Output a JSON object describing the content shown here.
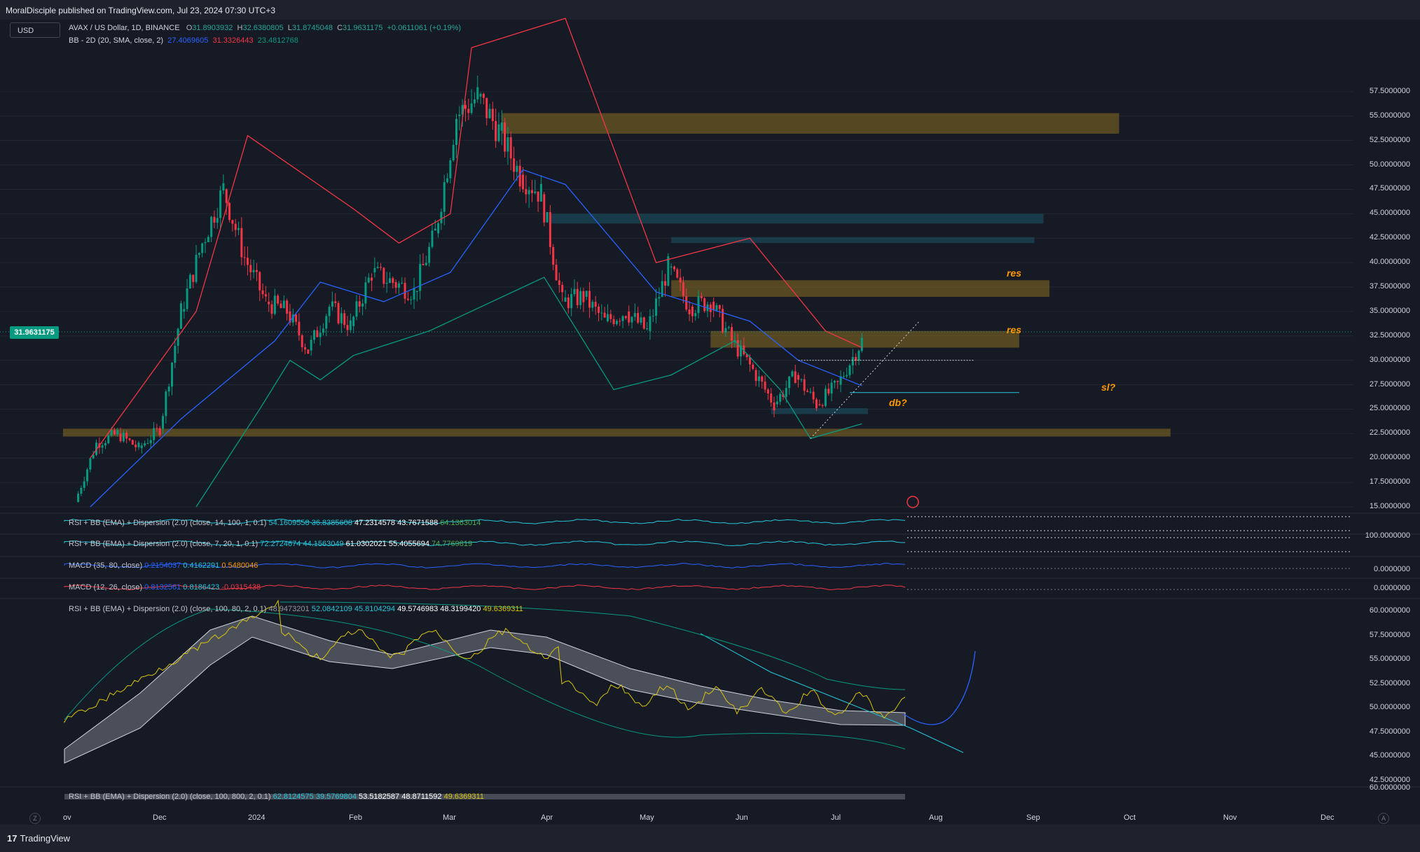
{
  "header": {
    "published_by": "MoralDisciple published on TradingView.com, Jul 23, 2024 07:30 UTC+3"
  },
  "currency_selector": "USD",
  "main_legend": {
    "symbol": "AVAX / US Dollar, 1D, BINANCE",
    "open_label": "O",
    "open": "31.8903932",
    "high_label": "H",
    "high": "32.6380805",
    "low_label": "L",
    "low": "31.8745048",
    "close_label": "C",
    "close": "31.9631175",
    "change": "+0.0611061 (+0.19%)"
  },
  "bb_legend": {
    "name": "BB - 2D (20, SMA, close, 2)",
    "basis": "27.4069605",
    "upper": "31.3326443",
    "lower": "23.4812768"
  },
  "last_price_tag": "31.9631175",
  "annotations": {
    "res1": "res",
    "res2": "res",
    "sl": "sl?",
    "db": "db?"
  },
  "panes": {
    "rsi1": {
      "name": "RSI + BB (EMA) + Dispersion (2.0) (close, 14, 100, 1, 0.1)",
      "v1": "54.1609558",
      "v2": "36.8385608",
      "v3": "47.2314578",
      "v4": "43.7671588",
      "v5": "64.1363014"
    },
    "rsi2": {
      "name": "RSI + BB (EMA) + Dispersion (2.0) (close, 7, 20, 1, 0.1)",
      "v1": "72.2724674",
      "v2": "44.1563049",
      "v3": "61.0302021",
      "v4": "55.4055694",
      "v5": "74.7769819",
      "axis": "100.0000000"
    },
    "macd1": {
      "name": "MACD (35, 80, close)",
      "v1": "0.2154037",
      "v2": "0.4162291",
      "v3": "0.5480046",
      "axis": "0.0000000"
    },
    "macd2": {
      "name": "MACD (12, 26, close)",
      "v1": "0.8132561",
      "v2": "0.8186423",
      "v3": "-0.0315438",
      "axis": "0.0000000"
    },
    "rsi3": {
      "name": "RSI + BB (EMA) + Dispersion (2.0) (close, 100, 80, 2, 0.1)",
      "v0": "48.9473201",
      "v1": "52.0842109",
      "v2": "45.8104294",
      "v3": "49.5746983",
      "v4": "48.3199420",
      "v5": "49.6369311",
      "axis_labels": [
        "60.0000000",
        "57.5000000",
        "55.0000000",
        "52.5000000",
        "50.0000000",
        "47.5000000",
        "45.0000000",
        "42.5000000"
      ]
    },
    "rsi4": {
      "name": "RSI + BB (EMA) + Dispersion (2.0) (close, 100, 800, 2, 0.1)",
      "v1": "62.8124575",
      "v2": "39.5769804",
      "v3": "53.5182587",
      "v4": "48.8711592",
      "v5": "49.6369311",
      "axis": "60.0000000"
    }
  },
  "price_axis_labels": [
    "57.5000000",
    "55.0000000",
    "52.5000000",
    "50.0000000",
    "47.5000000",
    "45.0000000",
    "42.5000000",
    "40.0000000",
    "37.5000000",
    "35.0000000",
    "32.5000000",
    "30.0000000",
    "27.5000000",
    "25.0000000",
    "22.5000000",
    "20.0000000",
    "17.5000000",
    "15.0000000"
  ],
  "time_axis_labels": [
    "ov",
    "Dec",
    "2024",
    "Feb",
    "Mar",
    "Apr",
    "May",
    "Jun",
    "Jul",
    "Aug",
    "Sep",
    "Oct",
    "Nov",
    "Dec"
  ],
  "footer": {
    "logo_glyph": "17",
    "brand": "TradingView",
    "left_btn": "Z",
    "right_btn": "A"
  },
  "colors": {
    "up": "#089981",
    "down": "#f23645",
    "bb_basis": "#2962ff",
    "bb_upper": "#f23645",
    "bb_lower": "#089981",
    "zone_orange": "#8a6d1f",
    "zone_blue": "#1e5566"
  },
  "chart_data": {
    "type": "candlestick",
    "title": "AVAX / US Dollar, 1D, BINANCE",
    "y_range": [
      15,
      60
    ],
    "x_range": [
      "2023-11-01",
      "2024-12-31"
    ],
    "close_path": [
      {
        "date": "2023-11-05",
        "close": 15.5
      },
      {
        "date": "2023-11-12",
        "close": 21.5
      },
      {
        "date": "2023-11-19",
        "close": 22.5
      },
      {
        "date": "2023-11-26",
        "close": 21.0
      },
      {
        "date": "2023-12-03",
        "close": 23.0
      },
      {
        "date": "2023-12-10",
        "close": 35.0
      },
      {
        "date": "2023-12-17",
        "close": 42.0
      },
      {
        "date": "2023-12-24",
        "close": 47.5
      },
      {
        "date": "2023-12-31",
        "close": 40.5
      },
      {
        "date": "2024-01-07",
        "close": 36.0
      },
      {
        "date": "2024-01-14",
        "close": 35.0
      },
      {
        "date": "2024-01-21",
        "close": 31.0
      },
      {
        "date": "2024-01-28",
        "close": 35.5
      },
      {
        "date": "2024-02-04",
        "close": 33.5
      },
      {
        "date": "2024-02-11",
        "close": 39.0
      },
      {
        "date": "2024-02-18",
        "close": 38.0
      },
      {
        "date": "2024-02-25",
        "close": 37.0
      },
      {
        "date": "2024-03-03",
        "close": 43.0
      },
      {
        "date": "2024-03-10",
        "close": 55.0
      },
      {
        "date": "2024-03-17",
        "close": 57.0
      },
      {
        "date": "2024-03-24",
        "close": 53.5
      },
      {
        "date": "2024-03-31",
        "close": 49.0
      },
      {
        "date": "2024-04-07",
        "close": 47.0
      },
      {
        "date": "2024-04-14",
        "close": 36.0
      },
      {
        "date": "2024-04-21",
        "close": 36.5
      },
      {
        "date": "2024-04-28",
        "close": 34.0
      },
      {
        "date": "2024-05-05",
        "close": 35.0
      },
      {
        "date": "2024-05-12",
        "close": 33.0
      },
      {
        "date": "2024-05-19",
        "close": 39.5
      },
      {
        "date": "2024-05-26",
        "close": 35.5
      },
      {
        "date": "2024-06-02",
        "close": 36.0
      },
      {
        "date": "2024-06-09",
        "close": 32.0
      },
      {
        "date": "2024-06-16",
        "close": 29.0
      },
      {
        "date": "2024-06-23",
        "close": 25.5
      },
      {
        "date": "2024-06-30",
        "close": 28.5
      },
      {
        "date": "2024-07-07",
        "close": 25.5
      },
      {
        "date": "2024-07-14",
        "close": 27.5
      },
      {
        "date": "2024-07-22",
        "close": 32.0
      }
    ],
    "bb_basis": [
      {
        "date": "2023-11-10",
        "value": 15.0
      },
      {
        "date": "2023-12-10",
        "value": 24.0
      },
      {
        "date": "2024-01-10",
        "value": 32.0
      },
      {
        "date": "2024-01-25",
        "value": 38.0
      },
      {
        "date": "2024-02-15",
        "value": 36.0
      },
      {
        "date": "2024-03-08",
        "value": 39.0
      },
      {
        "date": "2024-04-01",
        "value": 49.5
      },
      {
        "date": "2024-04-15",
        "value": 48.0
      },
      {
        "date": "2024-05-15",
        "value": 37.0
      },
      {
        "date": "2024-06-15",
        "value": 34.0
      },
      {
        "date": "2024-07-01",
        "value": 30.0
      },
      {
        "date": "2024-07-22",
        "value": 27.4
      }
    ],
    "bb_upper": [
      {
        "date": "2023-11-10",
        "value": 20.0
      },
      {
        "date": "2023-12-15",
        "value": 35.0
      },
      {
        "date": "2024-01-01",
        "value": 53.0
      },
      {
        "date": "2024-01-15",
        "value": 50.0
      },
      {
        "date": "2024-02-05",
        "value": 45.5
      },
      {
        "date": "2024-02-20",
        "value": 42.0
      },
      {
        "date": "2024-03-08",
        "value": 45.0
      },
      {
        "date": "2024-03-15",
        "value": 62.0
      },
      {
        "date": "2024-04-15",
        "value": 65.0
      },
      {
        "date": "2024-05-15",
        "value": 40.0
      },
      {
        "date": "2024-06-15",
        "value": 42.5
      },
      {
        "date": "2024-07-10",
        "value": 33.0
      },
      {
        "date": "2024-07-22",
        "value": 31.3
      }
    ],
    "bb_lower": [
      {
        "date": "2023-12-15",
        "value": 15.0
      },
      {
        "date": "2024-01-05",
        "value": 25.0
      },
      {
        "date": "2024-01-15",
        "value": 30.0
      },
      {
        "date": "2024-01-25",
        "value": 28.0
      },
      {
        "date": "2024-02-05",
        "value": 30.5
      },
      {
        "date": "2024-03-01",
        "value": 33.0
      },
      {
        "date": "2024-04-08",
        "value": 38.5
      },
      {
        "date": "2024-05-01",
        "value": 27.0
      },
      {
        "date": "2024-05-20",
        "value": 28.5
      },
      {
        "date": "2024-06-10",
        "value": 32.0
      },
      {
        "date": "2024-06-25",
        "value": 27.0
      },
      {
        "date": "2024-07-05",
        "value": 22.0
      },
      {
        "date": "2024-07-22",
        "value": 23.5
      }
    ],
    "zones": [
      {
        "label": "",
        "from": "2024-03-25",
        "to": "2024-10-15",
        "low": 53.2,
        "high": 55.3,
        "color": "orange"
      },
      {
        "label": "",
        "from": "2024-04-10",
        "to": "2024-09-20",
        "low": 44.0,
        "high": 45.0,
        "color": "blue"
      },
      {
        "label": "",
        "from": "2024-05-20",
        "to": "2024-09-17",
        "low": 42.0,
        "high": 42.6,
        "color": "blue"
      },
      {
        "label": "res",
        "from": "2024-05-20",
        "to": "2024-09-22",
        "low": 36.5,
        "high": 38.2,
        "color": "orange"
      },
      {
        "label": "res",
        "from": "2024-06-02",
        "to": "2024-09-12",
        "low": 31.3,
        "high": 33.0,
        "color": "orange"
      },
      {
        "label": "",
        "from": "2023-11-01",
        "to": "2024-11-01",
        "low": 22.2,
        "high": 23.0,
        "color": "orange"
      },
      {
        "label": "db?",
        "from": "2024-06-22",
        "to": "2024-07-24",
        "low": 24.5,
        "high": 25.1,
        "color": "blue"
      }
    ],
    "lines": [
      {
        "label": "sl?",
        "price": 26.7,
        "from": "2024-07-18",
        "to": "2024-09-12"
      },
      {
        "label": "",
        "price": 30.0,
        "from": "2024-07-01",
        "to": "2024-08-28"
      }
    ]
  }
}
